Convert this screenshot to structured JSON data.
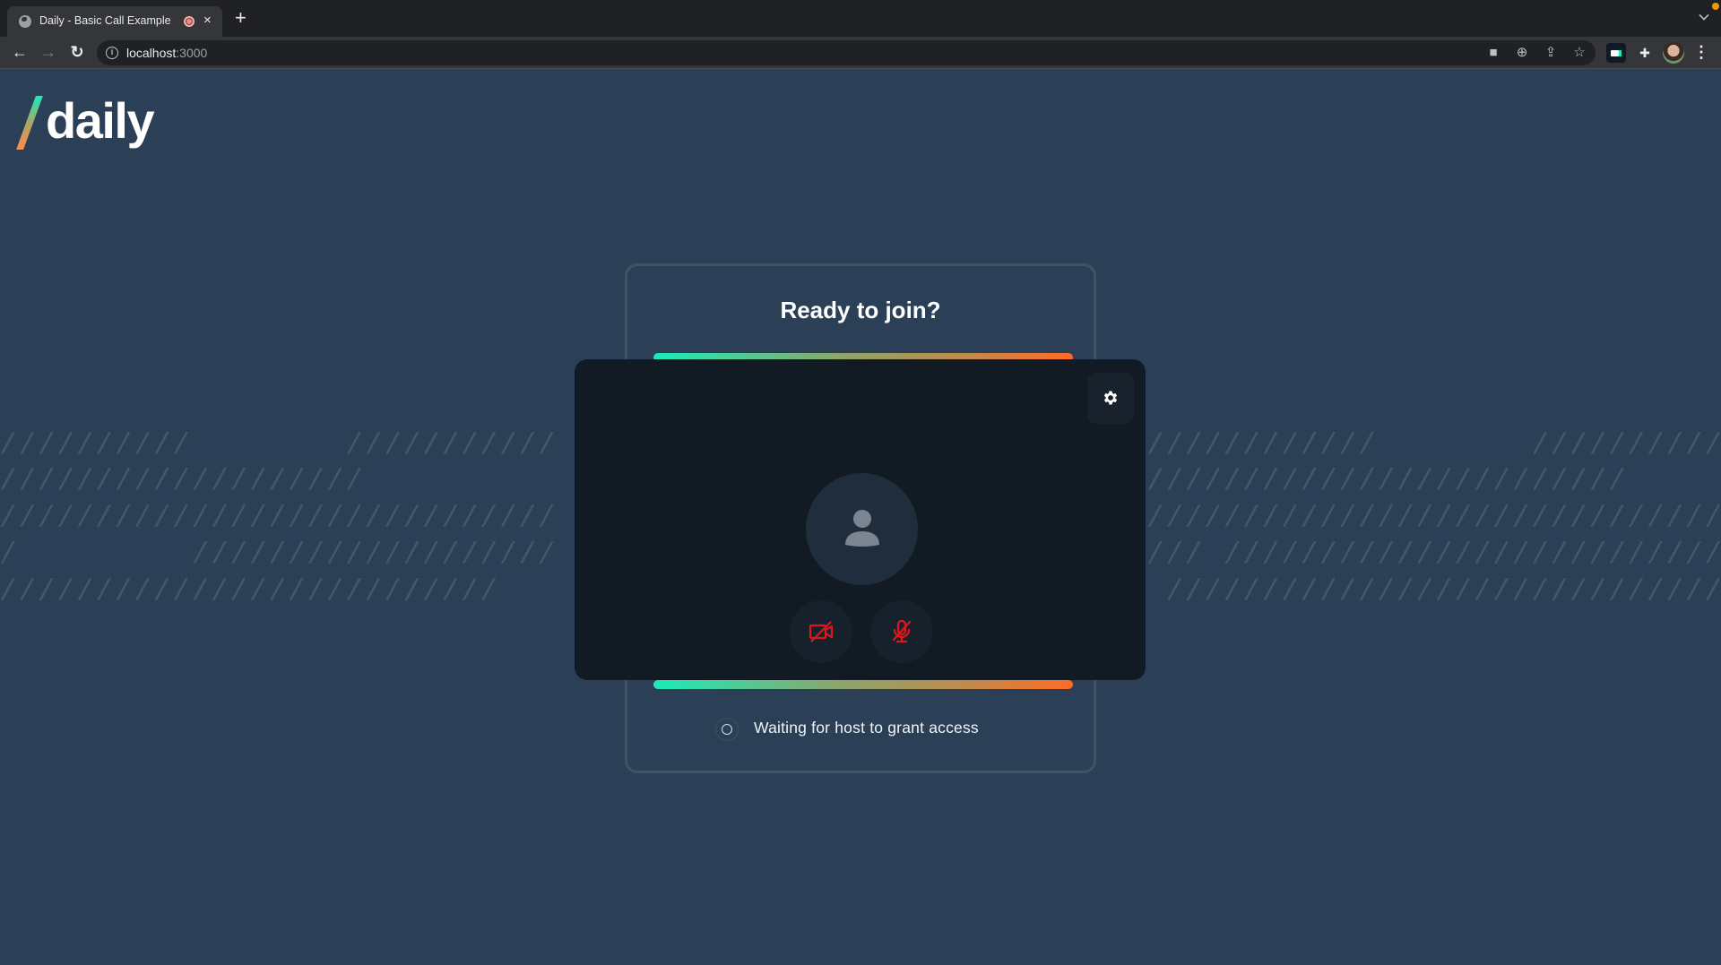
{
  "browser": {
    "tab": {
      "title": "Daily - Basic Call Example",
      "favicon": "globe-icon",
      "recording_indicator": "recording-dot-icon",
      "close": "×"
    },
    "new_tab": "+",
    "nav": {
      "back": "←",
      "forward": "→",
      "reload": "↻"
    },
    "address": {
      "host": "localhost",
      "port": ":3000",
      "info_icon": "i"
    },
    "omnibox_icons": [
      "camera-icon",
      "zoom-in-icon",
      "share-icon",
      "bookmark-star-icon"
    ],
    "omnibox_glyphs": {
      "camera": "■",
      "zoom": "⊕",
      "share": "⇪",
      "star": "☆"
    },
    "extensions": [
      "daily-extension-icon",
      "puzzle-extensions-icon"
    ],
    "puzzle_glyph": "✚",
    "menu_glyph": "⋮",
    "notification_color": "#f29900"
  },
  "page": {
    "logo": {
      "text": "daily",
      "accent_gradient": [
        "#1bebb9",
        "#ff8d4d"
      ]
    },
    "background_pattern": {
      "left_rows": [
        "//////////        ///////////////////",
        "///////////////////",
        "/////////////////////////////////////",
        "/         /////////////////////////////",
        "//////////////////////////"
      ],
      "right_rows": [
        "////////////        /////////////////////",
        "/////////////////////////        ////////",
        "///////////////////////////////////////////",
        "/// ///////////////////////////////////////",
        " ///////////////////////////////////////////"
      ]
    },
    "prejoin": {
      "title": "Ready to join?",
      "gradient_colors": [
        "#1bebb9",
        "#ff6b26"
      ],
      "settings_button": "settings-gear-icon",
      "camera_state": "off",
      "microphone_state": "muted",
      "muted_color": "#e0161c",
      "status_text": "Waiting for host to grant access"
    }
  }
}
